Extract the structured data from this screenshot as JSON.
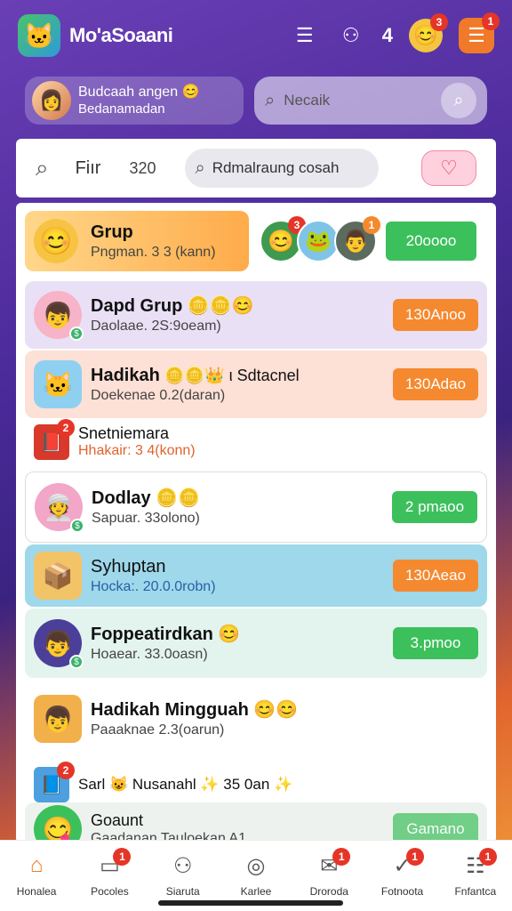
{
  "app": {
    "title": "Mo'aSoaani",
    "notification_count": "4"
  },
  "topbar": {
    "icons": [
      {
        "name": "list-icon",
        "glyph": "☰"
      },
      {
        "name": "user-icon",
        "glyph": "⚇"
      }
    ],
    "emoji_badge": "3",
    "menu_badge": "1"
  },
  "profile": {
    "name": "Budcaah angen",
    "subtitle": "Bedanamadan"
  },
  "search": {
    "placeholder": "Necaik"
  },
  "filter": {
    "label": "Fiır",
    "count": "320",
    "search_text": "Rdmalraung cosah"
  },
  "featured_group": {
    "title": "Grup",
    "subtitle": "Pngman. 3 3 (kann)",
    "avatar_badge_1": "3",
    "avatar_badge_2": "1",
    "button": "20oooo"
  },
  "rows": [
    {
      "name": "Dapd Grup",
      "emoji": "🪙🪙😊",
      "sub": "Daolaae. 2S:9oeam)",
      "button": "130Anoo",
      "btn_color": "orange"
    },
    {
      "name": "Hadikah",
      "emoji": "🪙🪙👑 ι Sdtacnel",
      "sub": "Doekenae 0.2(daran)",
      "button": "130Adao",
      "btn_color": "orange"
    },
    {
      "name": "Snetniemara",
      "emoji": "",
      "sub": "Hhakair: 3 4(konn)",
      "badge": "2"
    },
    {
      "name": "Dodlay",
      "emoji": "🪙🪙",
      "sub": "Sapuar. 33olono)",
      "button": "2 pmaoo",
      "btn_color": "green"
    },
    {
      "name": "Syhuptan",
      "emoji": "",
      "sub": "Hocka:. 20.0.0robn)",
      "button": "130Aeao",
      "btn_color": "orange"
    },
    {
      "name": "Foppeatirdkan",
      "emoji": "😊",
      "sub": "Hoaear. 33.0oasn)",
      "button": "3.pmoo",
      "btn_color": "green"
    },
    {
      "name": "Hadikah Mingguah",
      "emoji": "😊😊",
      "sub": "Paaaknae 2.3(oarun)"
    },
    {
      "name": "Sarl",
      "emoji": "😺 Nusanahl ✨ 35 0an ✨",
      "sub": "",
      "badge": "2"
    },
    {
      "name": "Goaunt",
      "emoji": "",
      "sub": "Gaadanan Tauloekan A1",
      "button": "Gamano",
      "btn_color": "green"
    }
  ],
  "nav": [
    {
      "label": "Honalea",
      "icon": "home-icon",
      "glyph": "⌂",
      "active": true
    },
    {
      "label": "Pocoles",
      "icon": "card-icon",
      "glyph": "▭",
      "badge": "1"
    },
    {
      "label": "Siaruta",
      "icon": "person-icon",
      "glyph": "⚇"
    },
    {
      "label": "Karlee",
      "icon": "shield-icon",
      "glyph": "◎"
    },
    {
      "label": "Droroda",
      "icon": "mail-icon",
      "glyph": "✉",
      "badge": "1"
    },
    {
      "label": "Fotnoota",
      "icon": "check-icon",
      "glyph": "✓",
      "badge": "1"
    },
    {
      "label": "Fnfantca",
      "icon": "settings-icon",
      "glyph": "☷",
      "badge": "1"
    }
  ]
}
